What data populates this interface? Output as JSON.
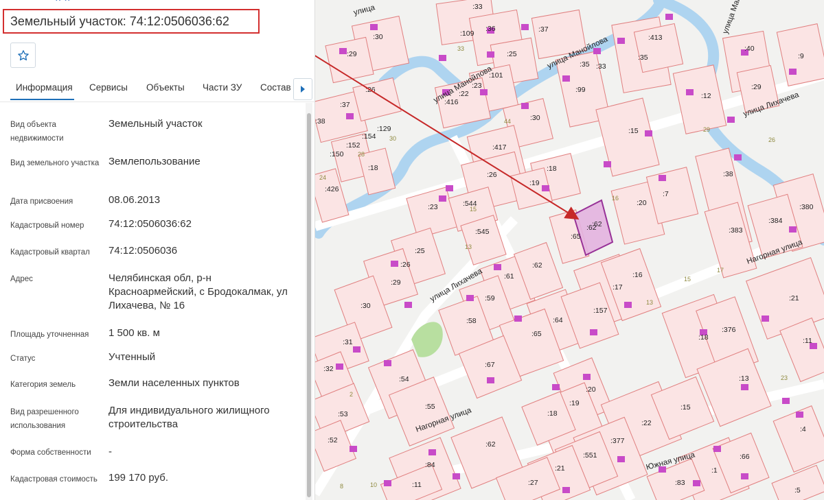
{
  "panel": {
    "title": "Земельный участок: 74:12:0506036:62",
    "tabs": [
      "Информация",
      "Сервисы",
      "Объекты",
      "Части ЗУ",
      "Состав"
    ],
    "rows": [
      {
        "label": "Вид объекта недвижимости",
        "value": "Земельный участок"
      },
      {
        "label": "Вид земельного участка",
        "value": "Землепользование"
      },
      {
        "label": "Дата присвоения",
        "value": "08.06.2013"
      },
      {
        "label": "Кадастровый номер",
        "value": "74:12:0506036:62"
      },
      {
        "label": "Кадастровый квартал",
        "value": "74:12:0506036"
      },
      {
        "label": "Адрес",
        "value": "Челябинская обл, р-н Красноармейский, с Бродокалмак, ул Лихачева, № 16"
      },
      {
        "label": "Площадь уточненная",
        "value": "1 500 кв. м"
      },
      {
        "label": "Статус",
        "value": "Учтенный"
      },
      {
        "label": "Категория земель",
        "value": "Земли населенных пунктов"
      },
      {
        "label": "Вид разрешенного использования",
        "value": "Для индивидуального жилищного строительства"
      },
      {
        "label": "Форма собственности",
        "value": "-"
      },
      {
        "label": "Кадастровая стоимость",
        "value": "199 170 руб."
      }
    ]
  },
  "map": {
    "streets": [
      "улица",
      "улица Манойлова",
      "улица Манойлова",
      "улица Манойлова",
      "улица Лихачева",
      "улица Лихачева",
      "Нагорная улица",
      "Нагорная улица",
      "Южная улица"
    ],
    "parcel_labels": [
      ":33",
      ":109",
      ":36",
      ":37",
      ":30",
      ":29",
      ":25",
      ":35",
      ":413",
      ":35",
      ":40",
      ":9",
      ":101",
      ":23",
      ":416",
      ":22",
      ":33",
      ":99",
      ":12",
      ":29",
      ":37",
      ":26",
      ":38",
      ":129",
      ":154",
      ":30",
      ":417",
      ":15",
      ":152",
      ":150",
      ":18",
      ":26",
      ":18",
      ":19",
      ":20",
      ":7",
      ":38",
      ":380",
      ":426",
      ":23",
      ":544",
      ":62",
      ":65",
      ":384",
      ":545",
      ":383",
      ":25",
      ":26",
      ":61",
      ":62",
      ":29",
      ":17",
      ":16",
      ":21",
      ":30",
      ":59",
      ":58",
      ":64",
      ":157",
      ":65",
      ":18",
      ":376",
      ":31",
      ":11",
      ":67",
      ":32",
      ":54",
      ":20",
      ":13",
      ":19",
      ":18",
      ":55",
      ":53",
      ":22",
      ":15",
      ":52",
      ":62",
      ":377",
      ":551",
      ":4",
      ":84",
      ":21",
      ":1",
      ":66",
      ":27",
      ":11",
      ":83",
      ":5"
    ],
    "building_numbers": [
      "33",
      "44",
      "30",
      "28",
      "24",
      "15",
      "13",
      "16",
      "17",
      "15",
      "26",
      "29",
      "13",
      "23",
      "2",
      "8",
      "10"
    ],
    "highlighted_parcel": ":62",
    "colors": {
      "parcel_stroke": "#e07f7f",
      "parcel_fill": "#fbe4e4",
      "highlight_stroke": "#8e1e8e",
      "highlight_fill": "#e4b3e0",
      "river": "#aed4f0",
      "arrow": "#c62828",
      "building": "#c84bc8"
    }
  }
}
